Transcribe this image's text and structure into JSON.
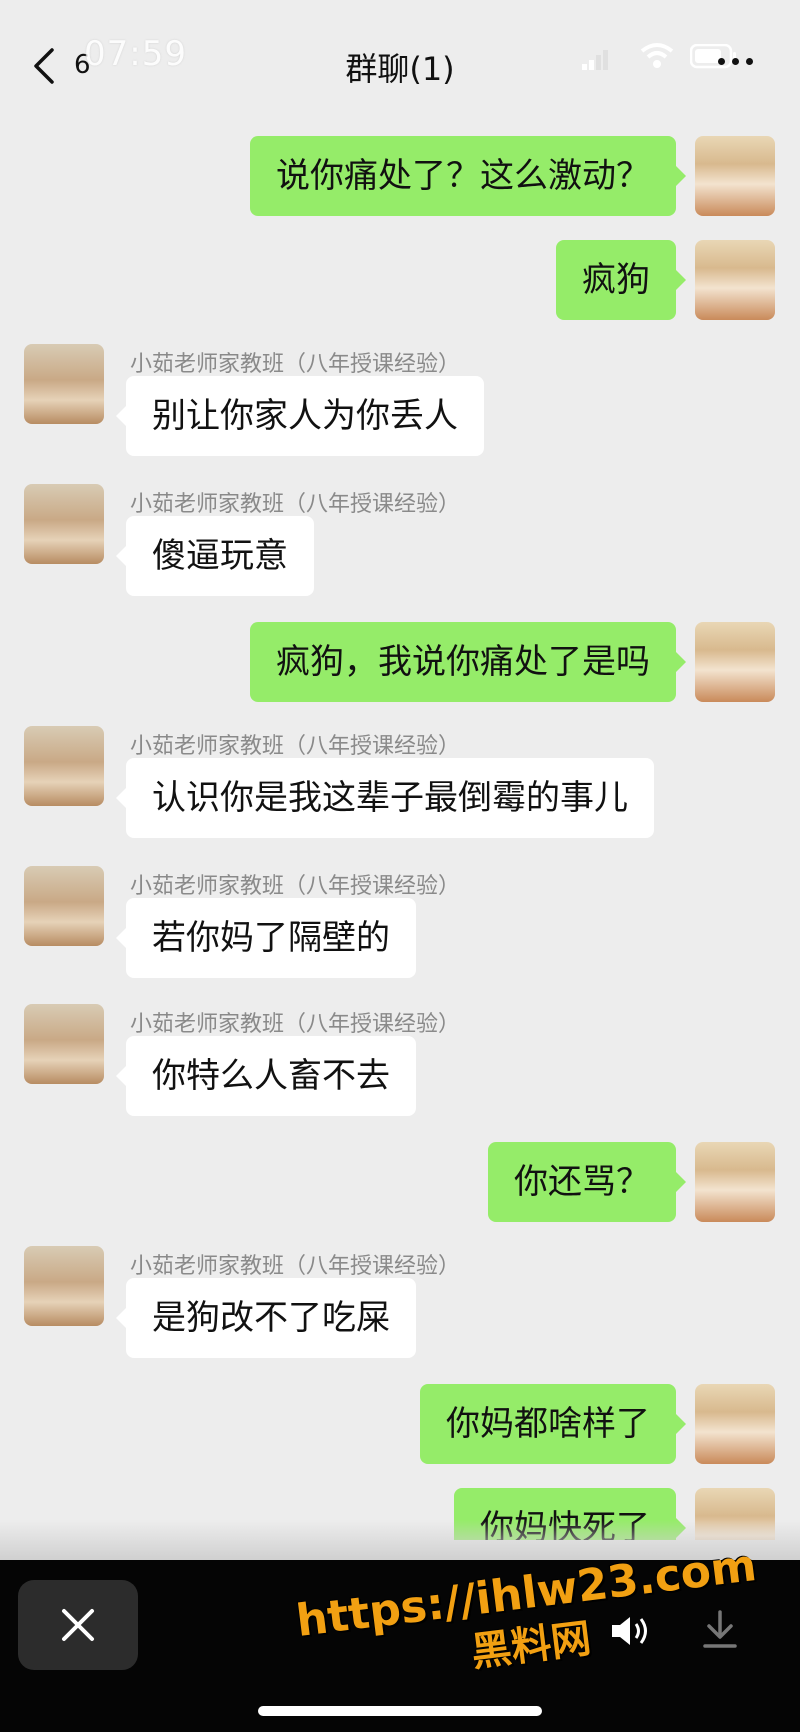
{
  "status_bar": {
    "time": "07:59"
  },
  "nav": {
    "back_count": "6",
    "title": "群聊(1)"
  },
  "messages": [
    {
      "side": "out",
      "text": "说你痛处了？这么激动？"
    },
    {
      "side": "out",
      "text": "疯狗"
    },
    {
      "side": "in",
      "sender": "小茹老师家教班（八年授课经验）",
      "text": "别让你家人为你丢人"
    },
    {
      "side": "in",
      "sender": "小茹老师家教班（八年授课经验）",
      "text": "傻逼玩意"
    },
    {
      "side": "out",
      "text": "疯狗，我说你痛处了是吗"
    },
    {
      "side": "in",
      "sender": "小茹老师家教班（八年授课经验）",
      "text": "认识你是我这辈子最倒霉的事儿"
    },
    {
      "side": "in",
      "sender": "小茹老师家教班（八年授课经验）",
      "text": "若你妈了隔壁的"
    },
    {
      "side": "in",
      "sender": "小茹老师家教班（八年授课经验）",
      "text": "你特么人畜不去"
    },
    {
      "side": "out",
      "text": "你还骂？"
    },
    {
      "side": "in",
      "sender": "小茹老师家教班（八年授课经验）",
      "text": "是狗改不了吃屎"
    },
    {
      "side": "out",
      "text": "你妈都啥样了"
    },
    {
      "side": "out",
      "text": "你妈快死了"
    }
  ],
  "watermark": {
    "url": "https://ihlw23.com",
    "name": "黑料网"
  },
  "icons": {
    "back": "chevron-left-icon",
    "more": "more-dots-icon",
    "close": "close-icon",
    "speaker": "speaker-icon",
    "download": "download-icon"
  },
  "colors": {
    "outgoing_bubble": "#95ec69",
    "incoming_bubble": "#ffffff",
    "background": "#ededed"
  }
}
